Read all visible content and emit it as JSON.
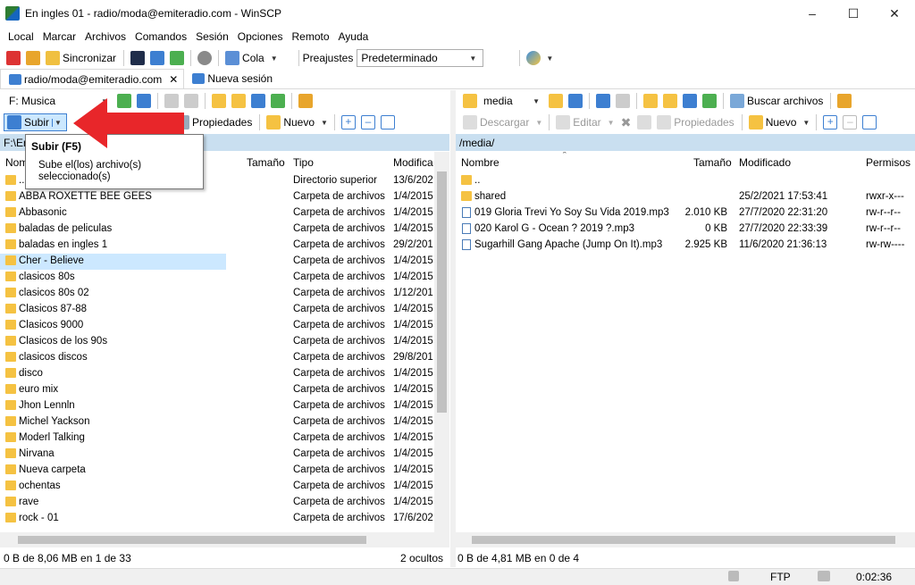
{
  "window": {
    "title": "En ingles 01 - radio/moda@emiteradio.com - WinSCP"
  },
  "menu": [
    "Local",
    "Marcar",
    "Archivos",
    "Comandos",
    "Sesión",
    "Opciones",
    "Remoto",
    "Ayuda"
  ],
  "toolbar": {
    "sync_label": "Sincronizar",
    "queue_label": "Cola",
    "presets_label": "Preajustes",
    "presets_value": "Predeterminado"
  },
  "tabs": [
    {
      "label": "radio/moda@emiteradio.com"
    },
    {
      "label": "Nueva sesión"
    }
  ],
  "left": {
    "drive": "F: Musica",
    "upload_label": "Subir",
    "properties_label": "Propiedades",
    "new_label": "Nuevo",
    "path": "F:\\En",
    "columns": {
      "name": "Nom",
      "size": "Tamaño",
      "type": "Tipo",
      "modified": "Modifica"
    },
    "rows": [
      {
        "name": "..",
        "type": "Directorio superior",
        "modified": "13/6/202"
      },
      {
        "name": "ABBA ROXETTE BEE GEES",
        "type": "Carpeta de archivos",
        "modified": "1/4/2015"
      },
      {
        "name": "Abbasonic",
        "type": "Carpeta de archivos",
        "modified": "1/4/2015"
      },
      {
        "name": "baladas de peliculas",
        "type": "Carpeta de archivos",
        "modified": "1/4/2015"
      },
      {
        "name": "baladas en ingles 1",
        "type": "Carpeta de archivos",
        "modified": "29/2/201"
      },
      {
        "name": "Cher - Believe",
        "type": "Carpeta de archivos",
        "modified": "1/4/2015"
      },
      {
        "name": "clasicos 80s",
        "type": "Carpeta de archivos",
        "modified": "1/4/2015"
      },
      {
        "name": "clasicos 80s 02",
        "type": "Carpeta de archivos",
        "modified": "1/12/201"
      },
      {
        "name": "Clasicos 87-88",
        "type": "Carpeta de archivos",
        "modified": "1/4/2015"
      },
      {
        "name": "Clasicos 9000",
        "type": "Carpeta de archivos",
        "modified": "1/4/2015"
      },
      {
        "name": "Clasicos de los 90s",
        "type": "Carpeta de archivos",
        "modified": "1/4/2015"
      },
      {
        "name": "clasicos discos",
        "type": "Carpeta de archivos",
        "modified": "29/8/201"
      },
      {
        "name": "disco",
        "type": "Carpeta de archivos",
        "modified": "1/4/2015"
      },
      {
        "name": "euro mix",
        "type": "Carpeta de archivos",
        "modified": "1/4/2015"
      },
      {
        "name": "Jhon Lennln",
        "type": "Carpeta de archivos",
        "modified": "1/4/2015"
      },
      {
        "name": "Michel Yackson",
        "type": "Carpeta de archivos",
        "modified": "1/4/2015"
      },
      {
        "name": "Moderl Talking",
        "type": "Carpeta de archivos",
        "modified": "1/4/2015"
      },
      {
        "name": "Nirvana",
        "type": "Carpeta de archivos",
        "modified": "1/4/2015"
      },
      {
        "name": "Nueva carpeta",
        "type": "Carpeta de archivos",
        "modified": "1/4/2015"
      },
      {
        "name": "ochentas",
        "type": "Carpeta de archivos",
        "modified": "1/4/2015"
      },
      {
        "name": "rave",
        "type": "Carpeta de archivos",
        "modified": "1/4/2015"
      },
      {
        "name": "rock - 01",
        "type": "Carpeta de archivos",
        "modified": "17/6/202"
      }
    ],
    "status": "0 B de 8,06 MB en 1 de 33",
    "hidden": "2 ocultos"
  },
  "right": {
    "folder": "media",
    "search_label": "Buscar archivos",
    "download_label": "Descargar",
    "edit_label": "Editar",
    "properties_label": "Propiedades",
    "new_label": "Nuevo",
    "path": "/media/",
    "columns": {
      "name": "Nombre",
      "size": "Tamaño",
      "modified": "Modificado",
      "perms": "Permisos"
    },
    "rows": [
      {
        "name": "..",
        "size": "",
        "modified": "",
        "perms": "",
        "kind": "up"
      },
      {
        "name": "shared",
        "size": "",
        "modified": "25/2/2021 17:53:41",
        "perms": "rwxr-x---",
        "kind": "folder"
      },
      {
        "name": "019 Gloria Trevi Yo Soy Su Vida 2019.mp3",
        "size": "2.010 KB",
        "modified": "27/7/2020 22:31:20",
        "perms": "rw-r--r--",
        "kind": "file"
      },
      {
        "name": "020 Karol G - Ocean ? 2019 ?.mp3",
        "size": "0 KB",
        "modified": "27/7/2020 22:33:39",
        "perms": "rw-r--r--",
        "kind": "file"
      },
      {
        "name": "Sugarhill Gang Apache (Jump On It).mp3",
        "size": "2.925 KB",
        "modified": "11/6/2020 21:36:13",
        "perms": "rw-rw----",
        "kind": "file"
      }
    ],
    "status": "0 B de 4,81 MB en 0 de 4"
  },
  "tooltip": {
    "title": "Subir (F5)",
    "line1": "Sube el(los) archivo(s)",
    "line2": "seleccionado(s)"
  },
  "bottom": {
    "protocol": "FTP",
    "time": "0:02:36"
  },
  "colors": {
    "path_bar": "#c9dff0",
    "selection": "#cce8ff",
    "arrow": "#e8262a"
  }
}
